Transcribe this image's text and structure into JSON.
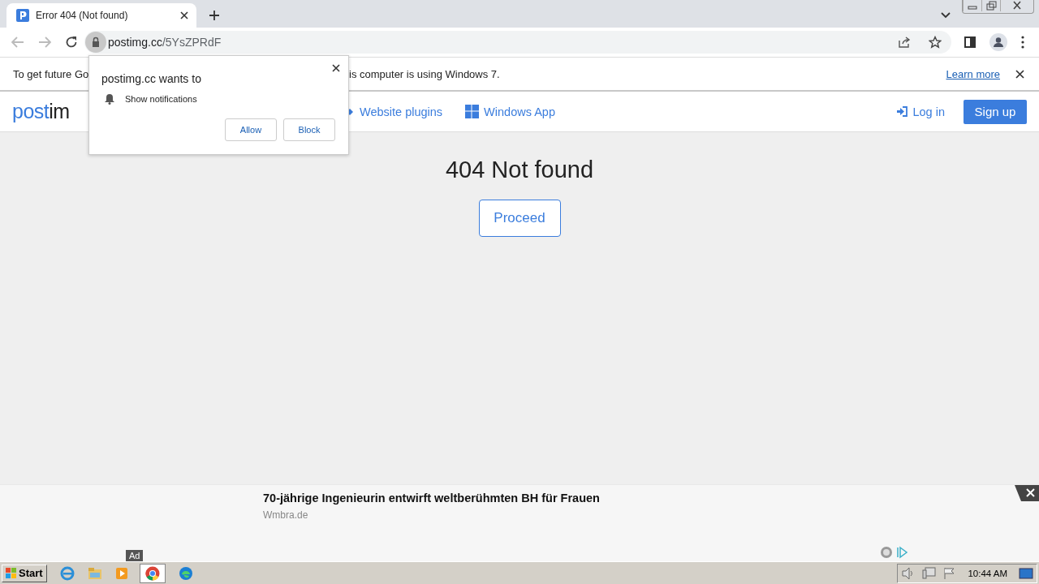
{
  "tabs": [
    {
      "title": "Error 404 (Not found)",
      "selected": true
    }
  ],
  "address_bar": {
    "host": "postimg.cc",
    "path": "/5YsZPRdF"
  },
  "infobar": {
    "text_start": "To get future Go",
    "text_end": "is computer is using Windows 7.",
    "link": "Learn more"
  },
  "permission_popup": {
    "title": "postimg.cc wants to",
    "permission": "Show notifications",
    "buttons": [
      "Allow",
      "Block"
    ]
  },
  "site_nav": {
    "logo": "postim",
    "links": [
      "Website plugins",
      "Windows App"
    ],
    "login": "Log in",
    "signup": "Sign up"
  },
  "main": {
    "heading": "404 Not found",
    "button": "Proceed"
  },
  "ad": {
    "headline": "70-jährige Ingenieurin entwirft weltberühmten BH für Frauen",
    "source": "Wmbra.de",
    "label": "Ad"
  },
  "taskbar": {
    "start": "Start",
    "clock": "10:44 AM"
  }
}
